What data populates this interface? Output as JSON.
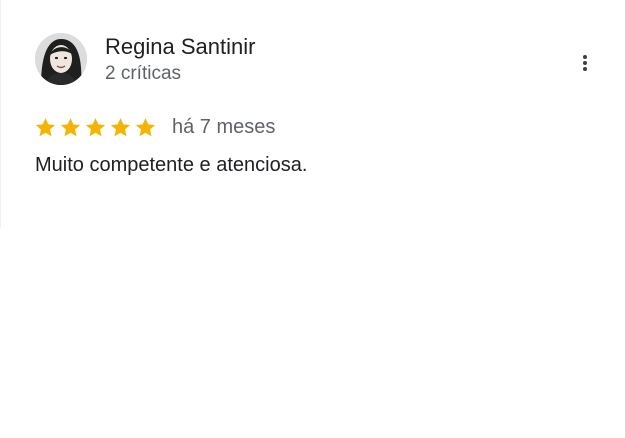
{
  "review": {
    "reviewer_name": "Regina Santinir",
    "review_count": "2 críticas",
    "rating": 5,
    "rating_max": 5,
    "date": "há 7 meses",
    "text": "Muito competente e atenciosa."
  },
  "icons": {
    "menu": "more-vert-icon",
    "star": "star-icon"
  },
  "colors": {
    "star": "#f6b400",
    "name": "#202124",
    "secondary": "#5f6368"
  }
}
